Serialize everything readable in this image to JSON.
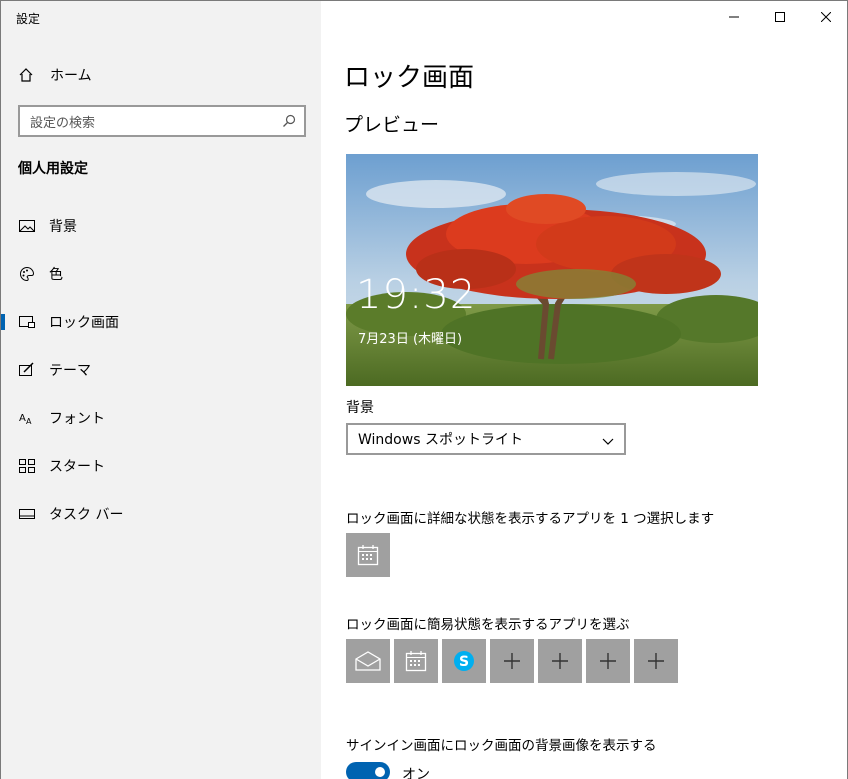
{
  "window": {
    "app_title": "設定",
    "controls": {
      "minimize_icon": "minimize-icon",
      "maximize_icon": "maximize-icon",
      "close_icon": "close-icon"
    }
  },
  "sidebar": {
    "home_label": "ホーム",
    "search_placeholder": "設定の検索",
    "section_title": "個人用設定",
    "items": [
      {
        "label": "背景",
        "icon": "picture-icon"
      },
      {
        "label": "色",
        "icon": "palette-icon"
      },
      {
        "label": "ロック画面",
        "icon": "lock-screen-icon",
        "active": true
      },
      {
        "label": "テーマ",
        "icon": "theme-icon"
      },
      {
        "label": "フォント",
        "icon": "font-icon"
      },
      {
        "label": "スタート",
        "icon": "start-icon"
      },
      {
        "label": "タスク バー",
        "icon": "taskbar-icon"
      }
    ],
    "accent_color": "#0063b1"
  },
  "main": {
    "page_title": "ロック画面",
    "preview_title": "プレビュー",
    "preview_time": "19:32",
    "preview_date": "7月23日 (木曜日)",
    "background_label": "背景",
    "background_value": "Windows スポットライト",
    "detailed_status_label": "ロック画面に詳細な状態を表示するアプリを 1 つ選択します",
    "detailed_status_apps": [
      "calendar-icon"
    ],
    "quick_status_label": "ロック画面に簡易状態を表示するアプリを選ぶ",
    "quick_status_apps": [
      "mail-icon",
      "calendar-icon",
      "skype-icon",
      "plus-icon",
      "plus-icon",
      "plus-icon",
      "plus-icon"
    ],
    "signin_label": "サインイン画面にロック画面の背景画像を表示する",
    "signin_toggle": "オン"
  }
}
